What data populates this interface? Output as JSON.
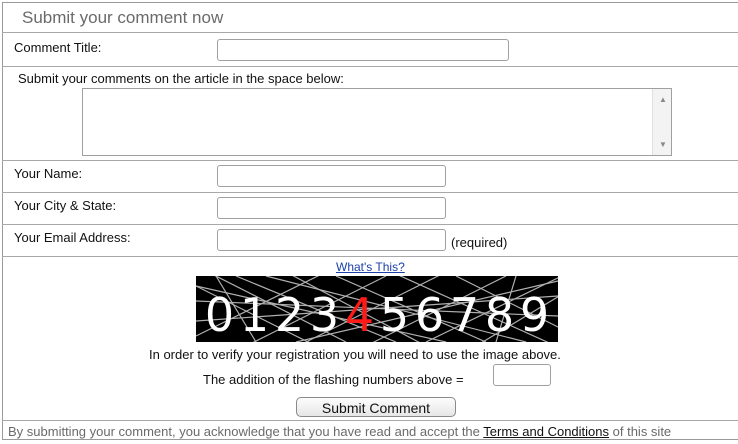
{
  "header": {
    "title": "Submit your comment now"
  },
  "form": {
    "comment_title_label": "Comment Title:",
    "comment_body_label": "Submit your comments on the article in the space below:",
    "name_label": "Your Name:",
    "city_state_label": "Your City & State:",
    "email_label": "Your Email Address:",
    "email_required": "(required)",
    "whats_this_link": "What's This?"
  },
  "captcha": {
    "digits": [
      "0",
      "1",
      "2",
      "3",
      "4",
      "5",
      "6",
      "7",
      "8",
      "9"
    ],
    "highlight_digit_index": 4,
    "highlight_color": "#ff1a1a",
    "verify_text": "In order to verify your registration you will need to use the image above.",
    "addition_label": "The addition of the flashing numbers above ="
  },
  "submit": {
    "label": "Submit Comment"
  },
  "footer": {
    "prefix": "By submitting your comment, you acknowledge that you have read and accept the",
    "terms_link": "Terms and Conditions",
    "suffix": "of this site"
  }
}
